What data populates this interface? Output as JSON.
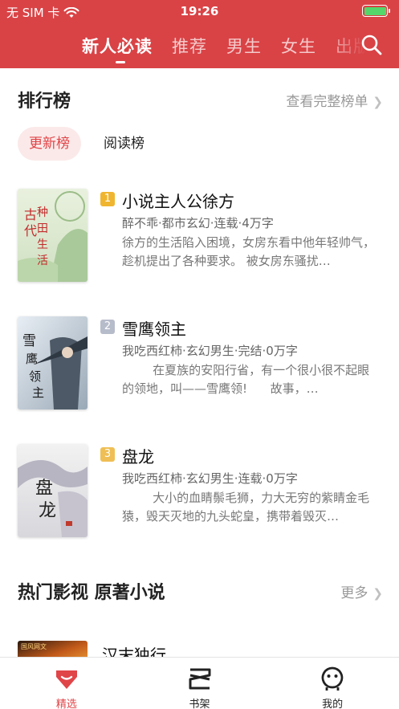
{
  "status_bar": {
    "carrier": "无 SIM 卡",
    "time": "19:26"
  },
  "top_tabs": [
    {
      "label": "新人必读",
      "active": true
    },
    {
      "label": "推荐",
      "active": false
    },
    {
      "label": "男生",
      "active": false
    },
    {
      "label": "女生",
      "active": false
    },
    {
      "label": "出版",
      "active": false
    }
  ],
  "ranking": {
    "title": "排行榜",
    "view_all": "查看完整榜单",
    "tabs": [
      {
        "label": "更新榜",
        "active": true
      },
      {
        "label": "阅读榜",
        "active": false
      }
    ],
    "books": [
      {
        "rank": "1",
        "title": "小说主人公徐方",
        "meta": "醉不乖·都市玄幻·连载·4万字",
        "desc": "徐方的生活陷入困境，女房东看中他年轻帅气，趁机提出了各种要求。 被女房东骚扰…",
        "badge_color": "#f0b530",
        "cover_text": "古代种田生活"
      },
      {
        "rank": "2",
        "title": "雪鹰领主",
        "meta": "我吃西红柿·玄幻男生·完结·0万字",
        "desc": "        在夏族的安阳行省，有一个很小很不起眼的领地，叫——雪鹰领!      故事，…",
        "badge_color": "#b7bccb",
        "cover_text": "雪鹰领主"
      },
      {
        "rank": "3",
        "title": "盘龙",
        "meta": "我吃西红柿·玄幻男生·连载·0万字",
        "desc": "        大小的血睛鬃毛狮，力大无穷的紫睛金毛猿，毁天灭地的九头蛇皇，携带着毁灭…",
        "badge_color": "#efbf55",
        "cover_text": "盘龙"
      }
    ]
  },
  "film_section": {
    "title": "热门影视 原著小说",
    "more": "更多",
    "first_book_title": "汉末独行",
    "first_cover_tag": "国风网文"
  },
  "bottom_nav": [
    {
      "label": "精选",
      "icon": "featured-gem-icon",
      "active": true
    },
    {
      "label": "书架",
      "icon": "bookshelf-icon",
      "active": false
    },
    {
      "label": "我的",
      "icon": "profile-face-icon",
      "active": false
    }
  ],
  "colors": {
    "header_red": "#d94346",
    "accent_red": "#e04548",
    "battery_green": "#55d66b"
  }
}
